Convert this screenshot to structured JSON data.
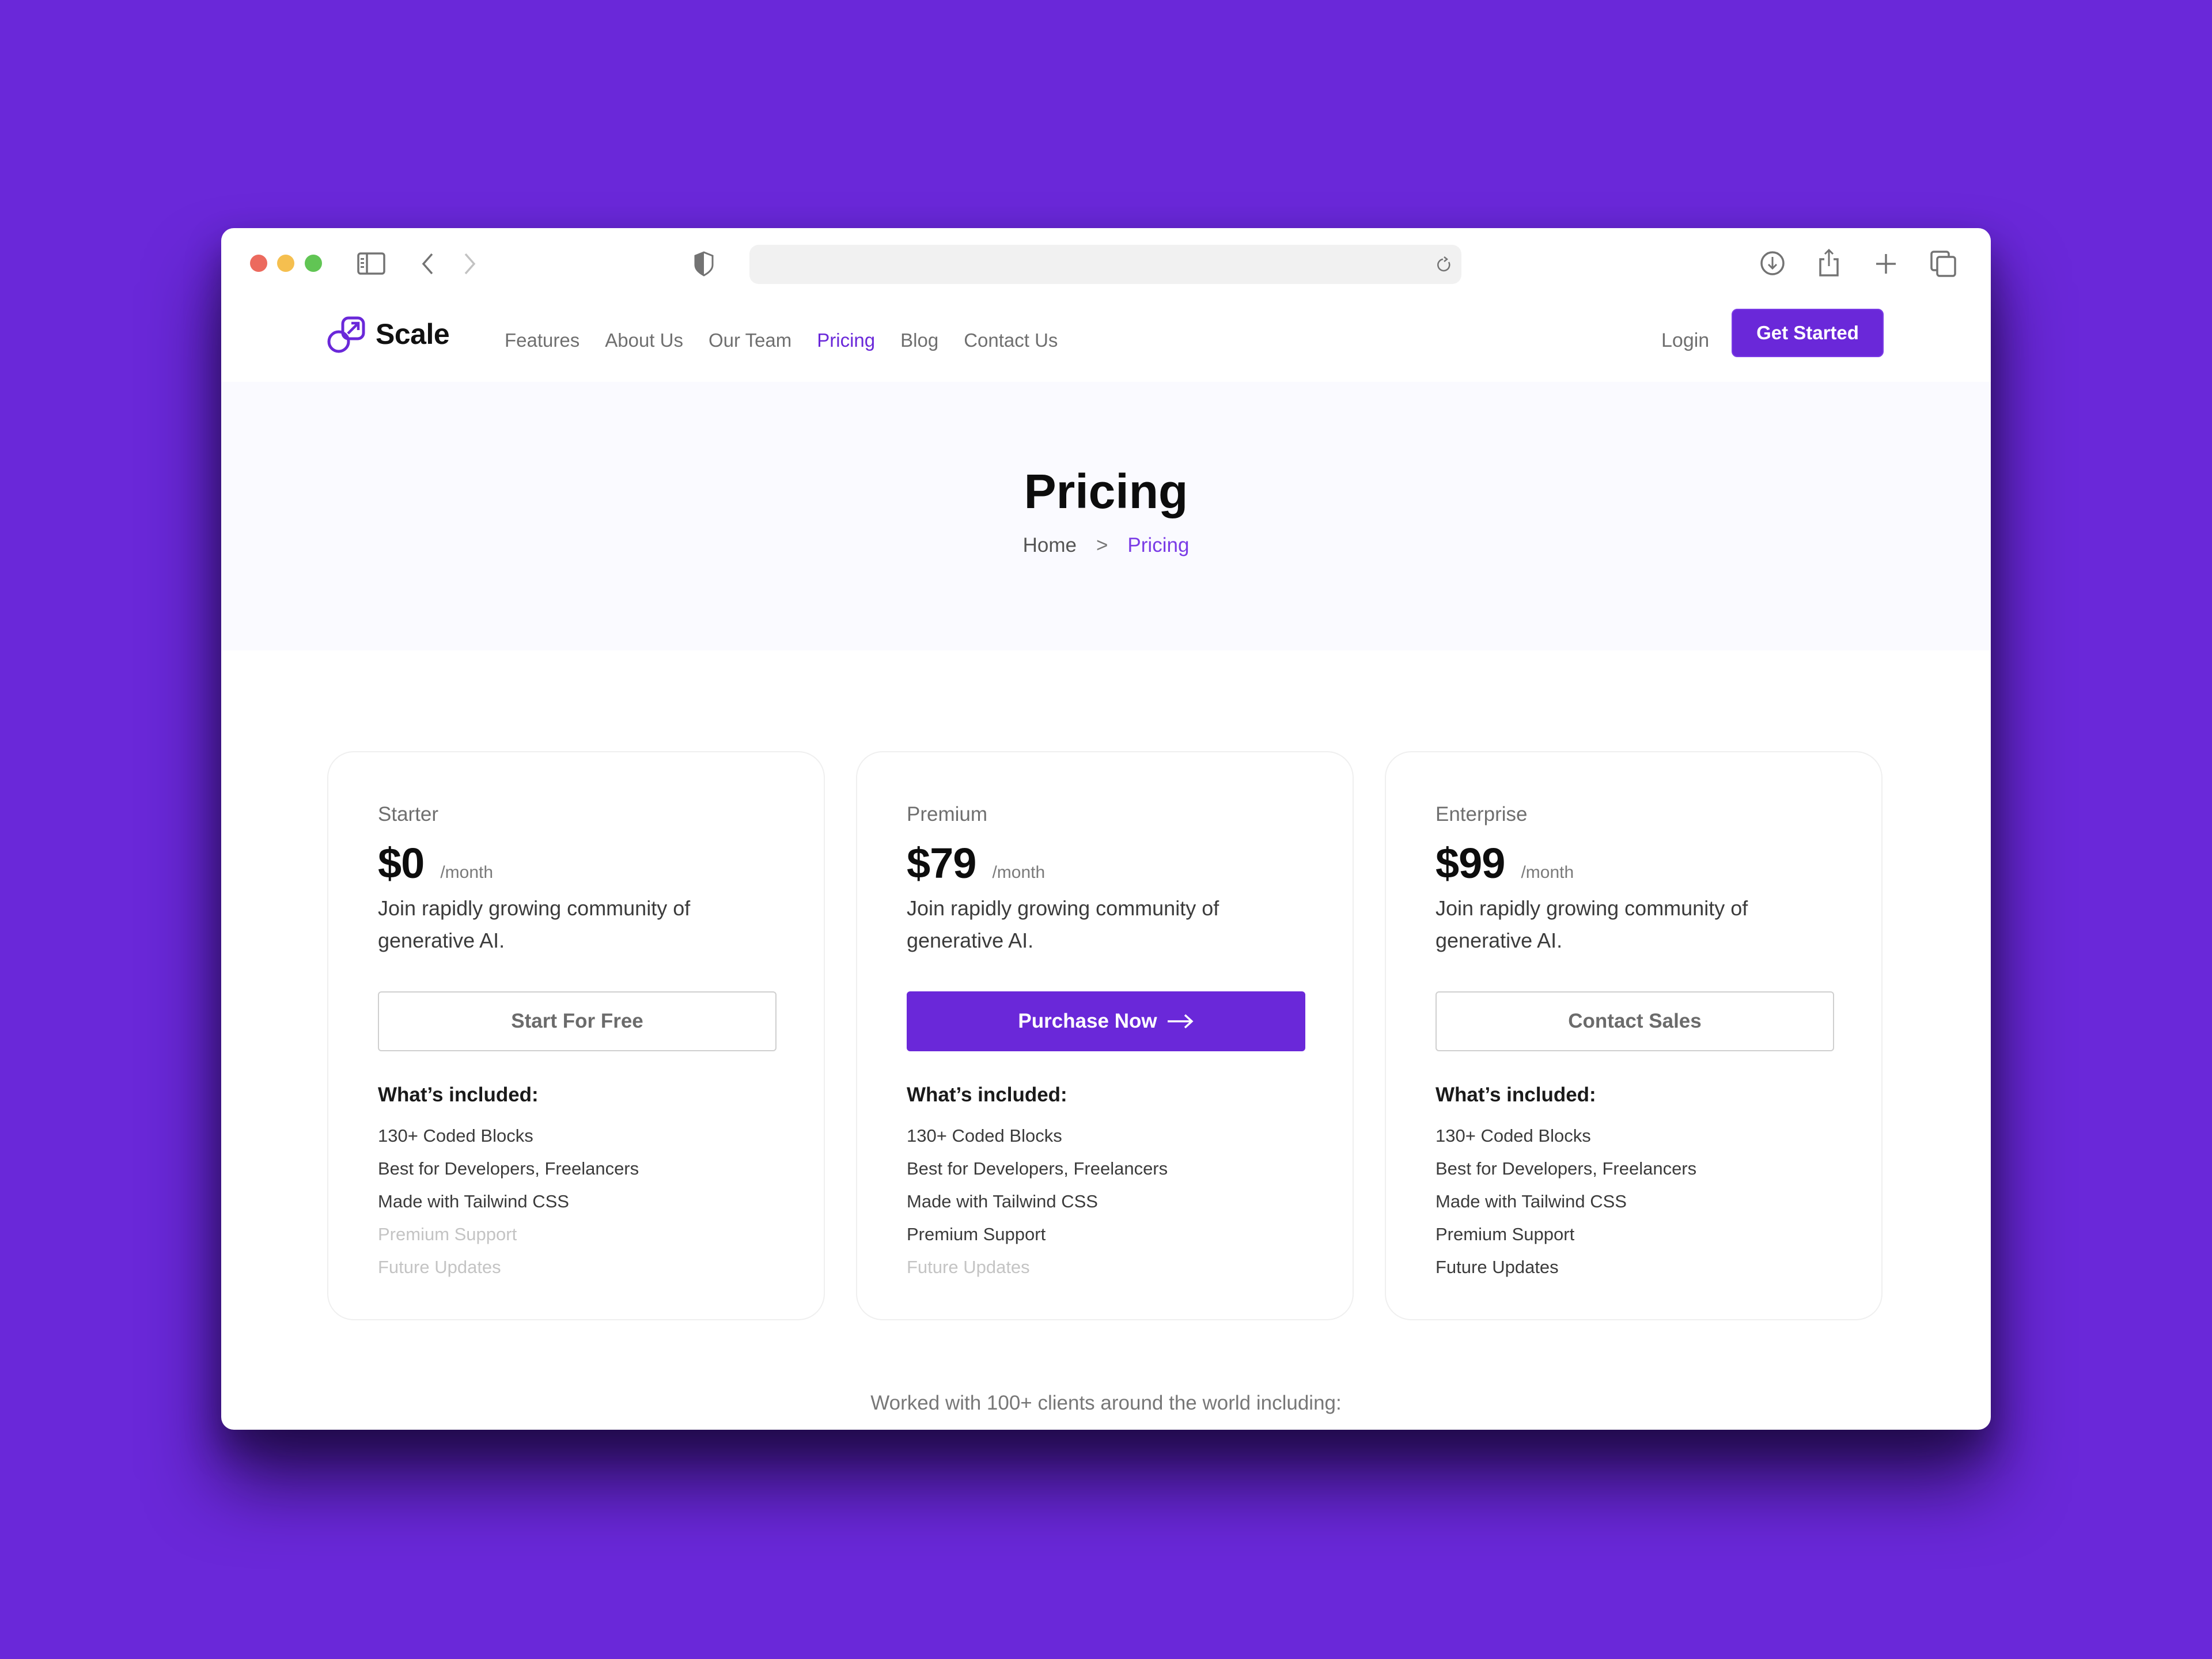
{
  "colors": {
    "brand": "#6a28d9",
    "background": "#6a28d9",
    "hero_bg": "#fafaff",
    "traffic_red": "#ec6a5e",
    "traffic_yellow": "#f5bf4f",
    "traffic_green": "#61c554"
  },
  "browser": {
    "address_bar": {
      "value": "",
      "placeholder": ""
    },
    "icons": {
      "sidebar": "sidebar-icon",
      "back": "chevron-left-icon",
      "forward": "chevron-right-icon",
      "privacy": "shield-icon",
      "reload": "reload-icon",
      "downloads": "download-icon",
      "share": "share-icon",
      "new_tab": "plus-icon",
      "tabs": "tabs-overview-icon"
    }
  },
  "nav": {
    "brand": "Scale",
    "links": [
      {
        "label": "Features",
        "active": false
      },
      {
        "label": "About Us",
        "active": false
      },
      {
        "label": "Our Team",
        "active": false
      },
      {
        "label": "Pricing",
        "active": true
      },
      {
        "label": "Blog",
        "active": false
      },
      {
        "label": "Contact Us",
        "active": false
      }
    ],
    "login_label": "Login",
    "cta_label": "Get Started"
  },
  "hero": {
    "title": "Pricing",
    "breadcrumb": {
      "home": "Home",
      "separator": ">",
      "current": "Pricing"
    }
  },
  "plans": [
    {
      "name": "Starter",
      "price": "$0",
      "period": "/month",
      "description": "Join rapidly growing community of generative AI.",
      "cta_label": "Start For Free",
      "cta_style": "outline",
      "included_title": "What’s included:",
      "features": [
        {
          "label": "130+ Coded Blocks",
          "included": true
        },
        {
          "label": "Best for Developers, Freelancers",
          "included": true
        },
        {
          "label": "Made with Tailwind CSS",
          "included": true
        },
        {
          "label": "Premium Support",
          "included": false
        },
        {
          "label": "Future Updates",
          "included": false
        }
      ]
    },
    {
      "name": "Premium",
      "price": "$79",
      "period": "/month",
      "description": "Join rapidly growing community of generative AI.",
      "cta_label": "Purchase Now",
      "cta_style": "primary",
      "cta_icon": "arrow-right-icon",
      "included_title": "What’s included:",
      "features": [
        {
          "label": "130+ Coded Blocks",
          "included": true
        },
        {
          "label": "Best for Developers, Freelancers",
          "included": true
        },
        {
          "label": "Made with Tailwind CSS",
          "included": true
        },
        {
          "label": "Premium Support",
          "included": true
        },
        {
          "label": "Future Updates",
          "included": false
        }
      ]
    },
    {
      "name": "Enterprise",
      "price": "$99",
      "period": "/month",
      "description": "Join rapidly growing community of generative AI.",
      "cta_label": "Contact Sales",
      "cta_style": "outline",
      "included_title": "What’s included:",
      "features": [
        {
          "label": "130+ Coded Blocks",
          "included": true
        },
        {
          "label": "Best for Developers, Freelancers",
          "included": true
        },
        {
          "label": "Made with Tailwind CSS",
          "included": true
        },
        {
          "label": "Premium Support",
          "included": true
        },
        {
          "label": "Future Updates",
          "included": true
        }
      ]
    }
  ],
  "clients_text": "Worked with 100+ clients around the world including:"
}
